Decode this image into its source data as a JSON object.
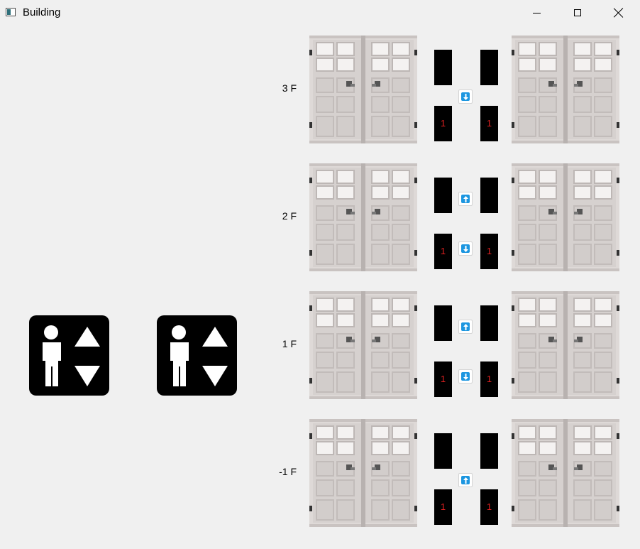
{
  "window": {
    "title": "Building"
  },
  "window_controls": [
    "minimize-button",
    "maximize-button",
    "close-button"
  ],
  "call_panels": [
    {
      "name": "elevator-call-panel-1",
      "icon": "person-up-down-icon"
    },
    {
      "name": "elevator-call-panel-2",
      "icon": "person-up-down-icon"
    }
  ],
  "floors": [
    {
      "label": "3 F",
      "elevator_a_floor": "1",
      "elevator_b_floor": "1",
      "up_button": false,
      "down_button": true
    },
    {
      "label": "2 F",
      "elevator_a_floor": "1",
      "elevator_b_floor": "1",
      "up_button": true,
      "down_button": true
    },
    {
      "label": "1 F",
      "elevator_a_floor": "1",
      "elevator_b_floor": "1",
      "up_button": true,
      "down_button": true
    },
    {
      "label": "-1 F",
      "elevator_a_floor": "1",
      "elevator_b_floor": "1",
      "up_button": true,
      "down_button": false
    }
  ],
  "colors": {
    "background": "#f0f0f0",
    "indicator_bg": "#000000",
    "indicator_text": "#e02020",
    "call_button": "#1c96e0",
    "door": "#dcd8d6"
  }
}
